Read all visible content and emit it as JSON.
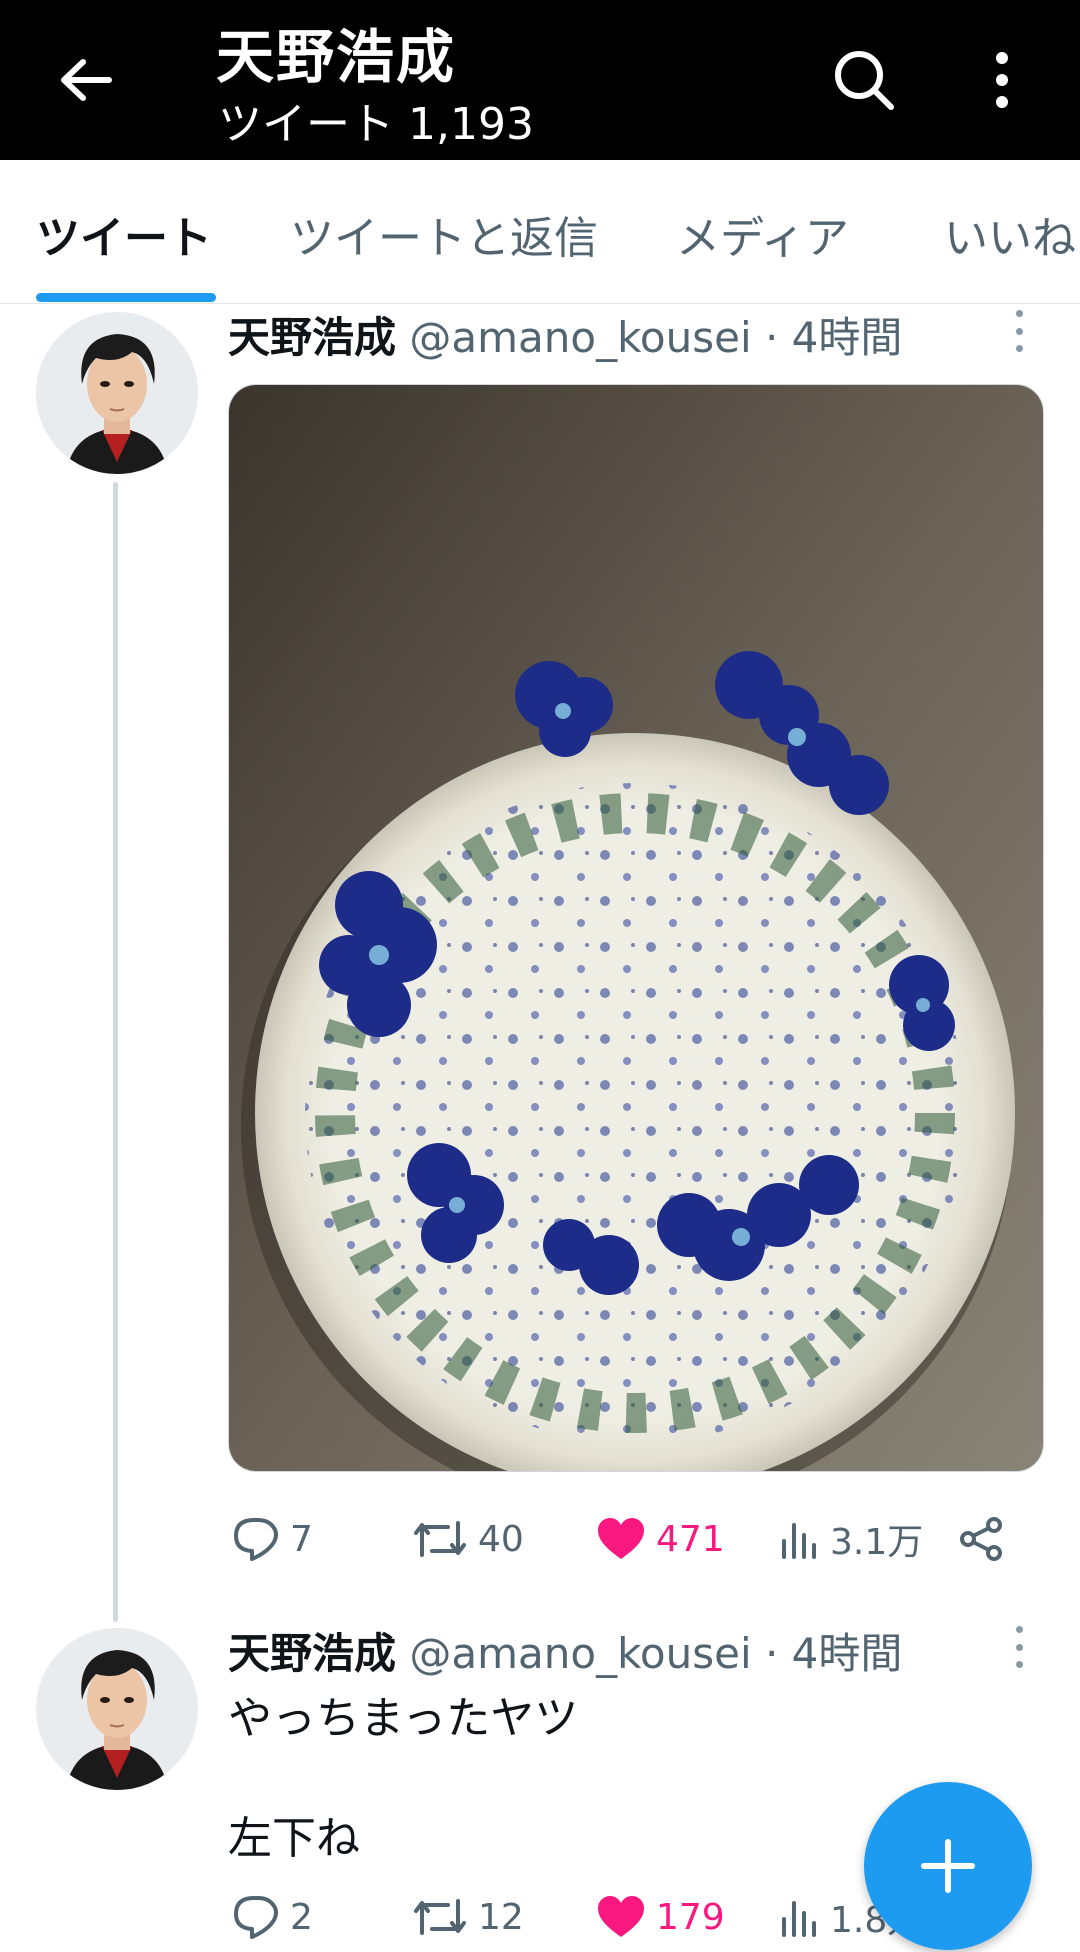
{
  "header": {
    "title": "天野浩成",
    "subtitle": "ツイート 1,193",
    "back_icon": "arrow-left-icon",
    "search_icon": "search-icon",
    "more_icon": "more-vertical-icon"
  },
  "tabs": [
    {
      "label": "ツイート",
      "active": true
    },
    {
      "label": "ツイートと返信",
      "active": false
    },
    {
      "label": "メディア",
      "active": false
    },
    {
      "label": "いいね",
      "active": false
    }
  ],
  "colors": {
    "accent": "#1d9bf0",
    "like": "#f91880",
    "secondary_text": "#536471",
    "header_bg": "#000000"
  },
  "tweets": [
    {
      "name": "天野浩成",
      "handle": "@amano_kousei",
      "time": "· 4時間",
      "text": "",
      "media": "patterned-plate-photo",
      "replies": "7",
      "retweets": "40",
      "likes": "471",
      "views": "3.1万"
    },
    {
      "name": "天野浩成",
      "handle": "@amano_kousei",
      "time": "· 4時間",
      "text_line1": "やっちまったヤツ",
      "text_line2": "左下ね",
      "replies": "2",
      "retweets": "12",
      "likes": "179",
      "views": "1.8万"
    }
  ],
  "fab": {
    "icon": "plus-icon"
  }
}
